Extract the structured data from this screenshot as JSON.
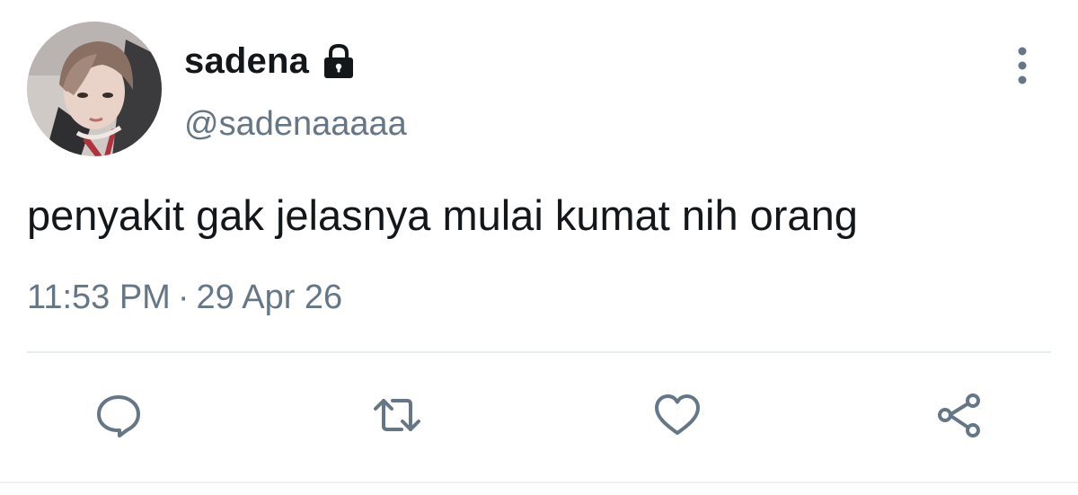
{
  "user": {
    "display_name": "sadena",
    "handle": "@sadenaaaaa",
    "protected_icon": "lock-icon",
    "avatar": "avatar-photo"
  },
  "tweet": {
    "text": "penyakit gak jelasnya mulai kumat nih orang",
    "time": "11:53 PM",
    "separator": "·",
    "date": "29 Apr 26"
  },
  "menu": {
    "icon": "more-vertical-icon"
  },
  "actions": [
    {
      "name": "reply",
      "icon": "comment-icon"
    },
    {
      "name": "retweet",
      "icon": "retweet-icon"
    },
    {
      "name": "like",
      "icon": "heart-icon"
    },
    {
      "name": "share",
      "icon": "share-icon"
    }
  ],
  "colors": {
    "text_primary": "#14171a",
    "text_secondary": "#657786",
    "icon_gray": "#657786",
    "divider": "#e6ecf0",
    "background": "#ffffff"
  }
}
